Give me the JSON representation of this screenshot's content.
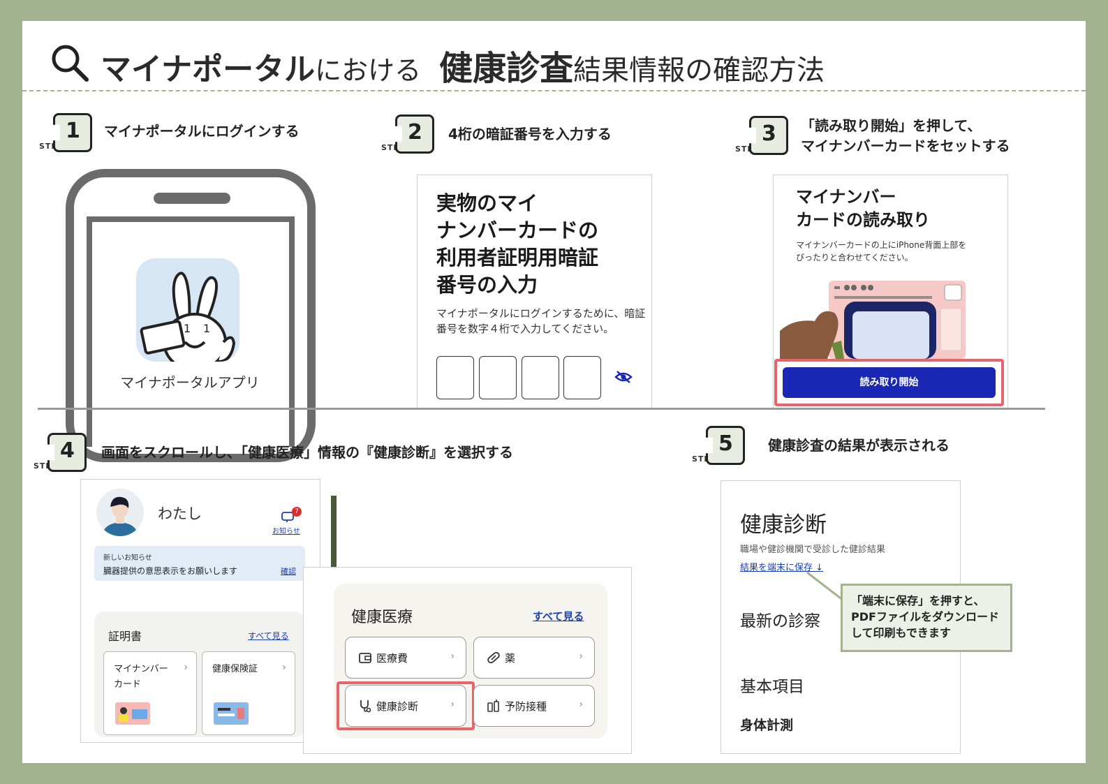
{
  "title": {
    "part1": "マイナポータル",
    "part2": "における",
    "part3": "健康診査",
    "part4": "結果情報の確認方法"
  },
  "step_word": "STEP",
  "steps": [
    {
      "num": "1",
      "text": "マイナポータルにログインする"
    },
    {
      "num": "2",
      "text": "4桁の暗証番号を入力する"
    },
    {
      "num": "3",
      "text_line1": "「読み取り開始」を押して、",
      "text_line2": "マイナンバーカードをセットする"
    },
    {
      "num": "4",
      "text": "画面をスクロールし、「健康医療」情報の『健康診断』を選択する"
    },
    {
      "num": "5",
      "text": "健康診査の結果が表示される"
    }
  ],
  "step1": {
    "app_label": "マイナポータルアプリ"
  },
  "step2": {
    "title_lines": [
      "実物のマイ",
      "ナンバーカードの",
      "利用者証明用暗証",
      "番号の入力"
    ],
    "desc_lines": [
      "マイナポータルにログインするために、暗証",
      "番号を数字４桁で入力してください。"
    ],
    "eye_icon": "eye-slash-icon"
  },
  "step3": {
    "title_lines": [
      "マイナンバー",
      "カードの読み取り"
    ],
    "desc_lines": [
      "マイナンバーカードの上にiPhone背面上部を",
      "ぴったりと合わせてください。"
    ],
    "button_label": "読み取り開始",
    "accent": "#1a27b5"
  },
  "step4": {
    "user_name": "わたし",
    "notice_badge": "7",
    "notice_link": "お知らせ",
    "bubble_small": "新しいお知らせ",
    "bubble_msg": "臓器提供の意思表示をお願いします",
    "bubble_confirm": "確認",
    "cert_title": "証明書",
    "cert_all": "すべて見る",
    "cert_items": [
      {
        "label_line1": "マイナンバー",
        "label_line2": "カード"
      },
      {
        "label_line1": "健康保険証",
        "label_line2": ""
      }
    ],
    "med_title": "健康医療",
    "med_all": "すべて見る",
    "med_items": [
      {
        "label": "医療費",
        "icon": "wallet-icon"
      },
      {
        "label": "薬",
        "icon": "pill-icon"
      },
      {
        "label": "健康診断",
        "icon": "stethoscope-icon"
      },
      {
        "label": "予防接種",
        "icon": "vaccine-icon"
      }
    ]
  },
  "step5": {
    "heading": "健康診断",
    "subtitle": "職場や健診機関で受診した健診結果",
    "save_link": "結果を端末に保存 ↓",
    "latest": "最新の診察",
    "basic": "基本項目",
    "body": "身体計測",
    "callout_lines": [
      "「端末に保存」を押すと、",
      "PDFファイルをダウンロード",
      "して印刷もできます"
    ]
  },
  "colors": {
    "frame": "#a3b38f",
    "highlight": "#e8646b",
    "link": "#1a3fb0"
  }
}
